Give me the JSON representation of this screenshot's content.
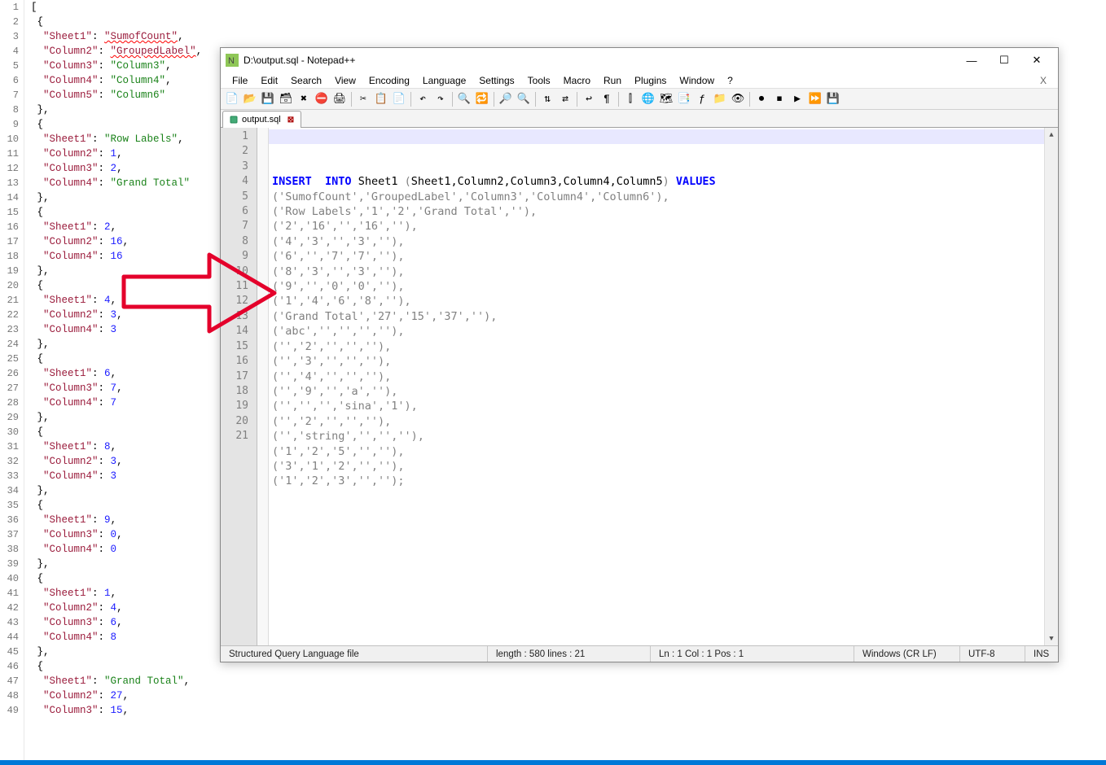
{
  "left_editor": {
    "lines": [
      {
        "n": 1,
        "html": "<span class='punct'>[</span>"
      },
      {
        "n": 2,
        "html": " <span class='punct'>{</span>"
      },
      {
        "n": 3,
        "html": "  <span class='key'>\"Sheet1\"</span>: <span class='str squig'>\"SumofCount\"</span>,"
      },
      {
        "n": 4,
        "html": "  <span class='key'>\"Column2\"</span>: <span class='str squig'>\"GroupedLabel\"</span>,"
      },
      {
        "n": 5,
        "html": "  <span class='key'>\"Column3\"</span>: <span class='str'>\"Column3\"</span>,"
      },
      {
        "n": 6,
        "html": "  <span class='key'>\"Column4\"</span>: <span class='str'>\"Column4\"</span>,"
      },
      {
        "n": 7,
        "html": "  <span class='key'>\"Column5\"</span>: <span class='str'>\"Column6\"</span>"
      },
      {
        "n": 8,
        "html": " <span class='punct'>},</span>"
      },
      {
        "n": 9,
        "html": " <span class='punct'>{</span>"
      },
      {
        "n": 10,
        "html": "  <span class='key'>\"Sheet1\"</span>: <span class='str'>\"Row Labels\"</span>,"
      },
      {
        "n": 11,
        "html": "  <span class='key'>\"Column2\"</span>: <span class='num'>1</span>,"
      },
      {
        "n": 12,
        "html": "  <span class='key'>\"Column3\"</span>: <span class='num'>2</span>,"
      },
      {
        "n": 13,
        "html": "  <span class='key'>\"Column4\"</span>: <span class='str'>\"Grand Total\"</span>"
      },
      {
        "n": 14,
        "html": " <span class='punct'>},</span>"
      },
      {
        "n": 15,
        "html": " <span class='punct'>{</span>"
      },
      {
        "n": 16,
        "html": "  <span class='key'>\"Sheet1\"</span>: <span class='num'>2</span>,"
      },
      {
        "n": 17,
        "html": "  <span class='key'>\"Column2\"</span>: <span class='num'>16</span>,"
      },
      {
        "n": 18,
        "html": "  <span class='key'>\"Column4\"</span>: <span class='num'>16</span>"
      },
      {
        "n": 19,
        "html": " <span class='punct'>},</span>"
      },
      {
        "n": 20,
        "html": " <span class='punct'>{</span>"
      },
      {
        "n": 21,
        "html": "  <span class='key'>\"Sheet1\"</span>: <span class='num'>4</span>,"
      },
      {
        "n": 22,
        "html": "  <span class='key'>\"Column2\"</span>: <span class='num'>3</span>,"
      },
      {
        "n": 23,
        "html": "  <span class='key'>\"Column4\"</span>: <span class='num'>3</span>"
      },
      {
        "n": 24,
        "html": " <span class='punct'>},</span>"
      },
      {
        "n": 25,
        "html": " <span class='punct'>{</span>"
      },
      {
        "n": 26,
        "html": "  <span class='key'>\"Sheet1\"</span>: <span class='num'>6</span>,"
      },
      {
        "n": 27,
        "html": "  <span class='key'>\"Column3\"</span>: <span class='num'>7</span>,"
      },
      {
        "n": 28,
        "html": "  <span class='key'>\"Column4\"</span>: <span class='num'>7</span>"
      },
      {
        "n": 29,
        "html": " <span class='punct'>},</span>"
      },
      {
        "n": 30,
        "html": " <span class='punct'>{</span>"
      },
      {
        "n": 31,
        "html": "  <span class='key'>\"Sheet1\"</span>: <span class='num'>8</span>,"
      },
      {
        "n": 32,
        "html": "  <span class='key'>\"Column2\"</span>: <span class='num'>3</span>,"
      },
      {
        "n": 33,
        "html": "  <span class='key'>\"Column4\"</span>: <span class='num'>3</span>"
      },
      {
        "n": 34,
        "html": " <span class='punct'>},</span>"
      },
      {
        "n": 35,
        "html": " <span class='punct'>{</span>"
      },
      {
        "n": 36,
        "html": "  <span class='key'>\"Sheet1\"</span>: <span class='num'>9</span>,"
      },
      {
        "n": 37,
        "html": "  <span class='key'>\"Column3\"</span>: <span class='num'>0</span>,"
      },
      {
        "n": 38,
        "html": "  <span class='key'>\"Column4\"</span>: <span class='num'>0</span>"
      },
      {
        "n": 39,
        "html": " <span class='punct'>},</span>"
      },
      {
        "n": 40,
        "html": " <span class='punct'>{</span>"
      },
      {
        "n": 41,
        "html": "  <span class='key'>\"Sheet1\"</span>: <span class='num'>1</span>,"
      },
      {
        "n": 42,
        "html": "  <span class='key'>\"Column2\"</span>: <span class='num'>4</span>,"
      },
      {
        "n": 43,
        "html": "  <span class='key'>\"Column3\"</span>: <span class='num'>6</span>,"
      },
      {
        "n": 44,
        "html": "  <span class='key'>\"Column4\"</span>: <span class='num'>8</span>"
      },
      {
        "n": 45,
        "html": " <span class='punct'>},</span>"
      },
      {
        "n": 46,
        "html": " <span class='punct'>{</span>"
      },
      {
        "n": 47,
        "html": "  <span class='key'>\"Sheet1\"</span>: <span class='str'>\"Grand Total\"</span>,"
      },
      {
        "n": 48,
        "html": "  <span class='key'>\"Column2\"</span>: <span class='num'>27</span>,"
      },
      {
        "n": 49,
        "html": "  <span class='key'>\"Column3\"</span>: <span class='num'>15</span>,"
      }
    ]
  },
  "npp": {
    "title": "D:\\output.sql - Notepad++",
    "menus": [
      "File",
      "Edit",
      "Search",
      "View",
      "Encoding",
      "Language",
      "Settings",
      "Tools",
      "Macro",
      "Run",
      "Plugins",
      "Window",
      "?"
    ],
    "tab": {
      "label": "output.sql"
    },
    "status": {
      "lang": "Structured Query Language file",
      "length": "length : 580    lines : 21",
      "pos": "Ln : 1    Col : 1    Pos : 1",
      "eol": "Windows (CR LF)",
      "enc": "UTF-8",
      "ins": "INS"
    },
    "code_lines": [
      {
        "n": 1,
        "html": "<span class='kw'>INSERT</span>  <span class='kw'>INTO</span> <span class='ident'>Sheet1</span> (<span class='ident'>Sheet1,Column2,Column3,Column4,Column5</span>) <span class='kw'>VALUES</span>"
      },
      {
        "n": 2,
        "html": "('SumofCount','GroupedLabel','Column3','Column4','Column6'),"
      },
      {
        "n": 3,
        "html": "('Row Labels','1','2','Grand Total',''),"
      },
      {
        "n": 4,
        "html": "('2','16','','16',''),"
      },
      {
        "n": 5,
        "html": "('4','3','','3',''),"
      },
      {
        "n": 6,
        "html": "('6','','7','7',''),"
      },
      {
        "n": 7,
        "html": "('8','3','','3',''),"
      },
      {
        "n": 8,
        "html": "('9','','0','0',''),"
      },
      {
        "n": 9,
        "html": "('1','4','6','8',''),"
      },
      {
        "n": 10,
        "html": "('Grand Total','27','15','37',''),"
      },
      {
        "n": 11,
        "html": "('abc','','','',''),"
      },
      {
        "n": 12,
        "html": "('','2','','',''),"
      },
      {
        "n": 13,
        "html": "('','3','','',''),"
      },
      {
        "n": 14,
        "html": "('','4','','',''),"
      },
      {
        "n": 15,
        "html": "('','9','','a',''),"
      },
      {
        "n": 16,
        "html": "('','','','sina','1'),"
      },
      {
        "n": 17,
        "html": "('','2','','',''),"
      },
      {
        "n": 18,
        "html": "('','string','','',''),"
      },
      {
        "n": 19,
        "html": "('1','2','5','',''),"
      },
      {
        "n": 20,
        "html": "('3','1','2','',''),"
      },
      {
        "n": 21,
        "html": "('1','2','3','','');"
      }
    ]
  },
  "toolbar_icons": [
    {
      "name": "new-file-icon",
      "glyph": "📄"
    },
    {
      "name": "open-file-icon",
      "glyph": "📂"
    },
    {
      "name": "save-icon",
      "glyph": "💾"
    },
    {
      "name": "save-all-icon",
      "glyph": "🗃"
    },
    {
      "name": "close-icon",
      "glyph": "✖"
    },
    {
      "name": "close-all-icon",
      "glyph": "⛔"
    },
    {
      "name": "print-icon",
      "glyph": "🖨"
    },
    {
      "sep": true
    },
    {
      "name": "cut-icon",
      "glyph": "✂"
    },
    {
      "name": "copy-icon",
      "glyph": "📋"
    },
    {
      "name": "paste-icon",
      "glyph": "📄"
    },
    {
      "sep": true
    },
    {
      "name": "undo-icon",
      "glyph": "↶"
    },
    {
      "name": "redo-icon",
      "glyph": "↷"
    },
    {
      "sep": true
    },
    {
      "name": "find-icon",
      "glyph": "🔍"
    },
    {
      "name": "replace-icon",
      "glyph": "🔁"
    },
    {
      "sep": true
    },
    {
      "name": "zoom-in-icon",
      "glyph": "🔎"
    },
    {
      "name": "zoom-out-icon",
      "glyph": "🔍"
    },
    {
      "sep": true
    },
    {
      "name": "sync-v-icon",
      "glyph": "⇅"
    },
    {
      "name": "sync-h-icon",
      "glyph": "⇄"
    },
    {
      "sep": true
    },
    {
      "name": "wrap-icon",
      "glyph": "↩"
    },
    {
      "name": "all-chars-icon",
      "glyph": "¶"
    },
    {
      "sep": true
    },
    {
      "name": "indent-guide-icon",
      "glyph": "⫿"
    },
    {
      "name": "lang-icon",
      "glyph": "🌐"
    },
    {
      "name": "doc-map-icon",
      "glyph": "🗺"
    },
    {
      "name": "doc-list-icon",
      "glyph": "📑"
    },
    {
      "name": "func-list-icon",
      "glyph": "ƒ"
    },
    {
      "name": "folder-icon",
      "glyph": "📁"
    },
    {
      "name": "monitor-icon",
      "glyph": "👁"
    },
    {
      "sep": true
    },
    {
      "name": "record-icon",
      "glyph": "⏺"
    },
    {
      "name": "stop-icon",
      "glyph": "⏹"
    },
    {
      "name": "play-icon",
      "glyph": "▶"
    },
    {
      "name": "fast-icon",
      "glyph": "⏩"
    },
    {
      "name": "save-macro-icon",
      "glyph": "💾"
    }
  ]
}
